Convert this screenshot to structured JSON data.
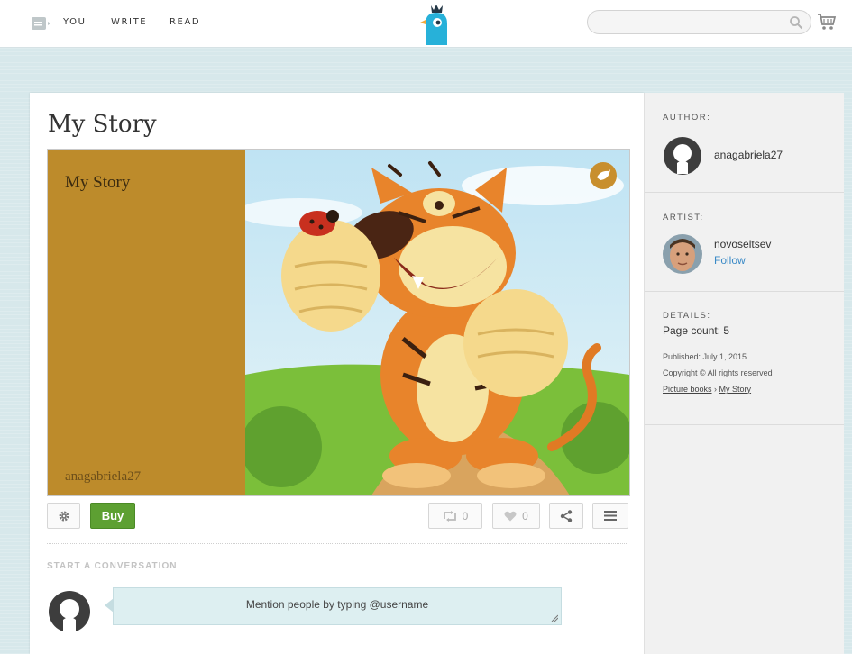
{
  "nav": {
    "you": "YOU",
    "write": "WRITE",
    "read": "READ"
  },
  "search": {
    "placeholder": ""
  },
  "story": {
    "title": "My Story",
    "cover_title": "My Story",
    "cover_author": "anagabriela27"
  },
  "actions": {
    "buy": "Buy",
    "repost_count": "0",
    "like_count": "0"
  },
  "conversation": {
    "label": "START A CONVERSATION",
    "comment_text": "Mention people by typing @username"
  },
  "sidebar": {
    "author_label": "AUTHOR:",
    "author_name": "anagabriela27",
    "artist_label": "ARTIST:",
    "artist_name": "novoseltsev",
    "follow": "Follow",
    "details_label": "DETAILS:",
    "page_count": "Page count: 5",
    "published": "Published: July 1, 2015",
    "copyright": "Copyright © All rights reserved",
    "category": "Picture books",
    "breadcrumb_sep": " › ",
    "breadcrumb_story": "My Story"
  },
  "colors": {
    "background": "#d7e8eb",
    "cover": "#bd8b2b",
    "buy_button": "#5da032",
    "link": "#3a8ac7"
  },
  "icons": [
    "menu-icon",
    "bird-logo-icon",
    "search-icon",
    "cart-icon",
    "bird-badge-icon",
    "gear-icon",
    "repost-icon",
    "heart-icon",
    "share-icon",
    "hamburger-icon",
    "resize-icon"
  ]
}
